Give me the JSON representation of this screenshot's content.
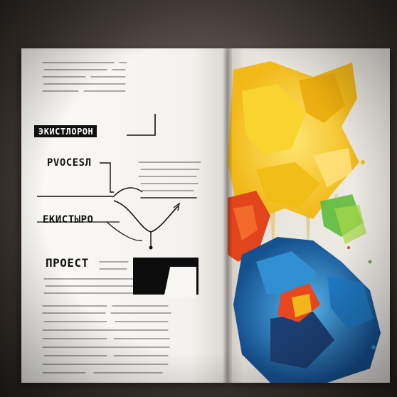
{
  "book": {
    "left_page": {
      "headings": [
        {
          "id": "bar",
          "text": "ЭКИСТЛОРОН"
        },
        {
          "id": "process",
          "text": "PVOCESЛ"
        },
        {
          "id": "ekistyro",
          "text": "ЕКИСТЫРО"
        },
        {
          "id": "proect",
          "text": "ПРОЕСТ"
        }
      ],
      "text_color": "#111111"
    },
    "right_page": {
      "artwork": "abstract-paint-splash",
      "palette": [
        "#f2c21b",
        "#e8461f",
        "#2f8fd0",
        "#5dbb3a",
        "#1c3f73"
      ]
    }
  }
}
